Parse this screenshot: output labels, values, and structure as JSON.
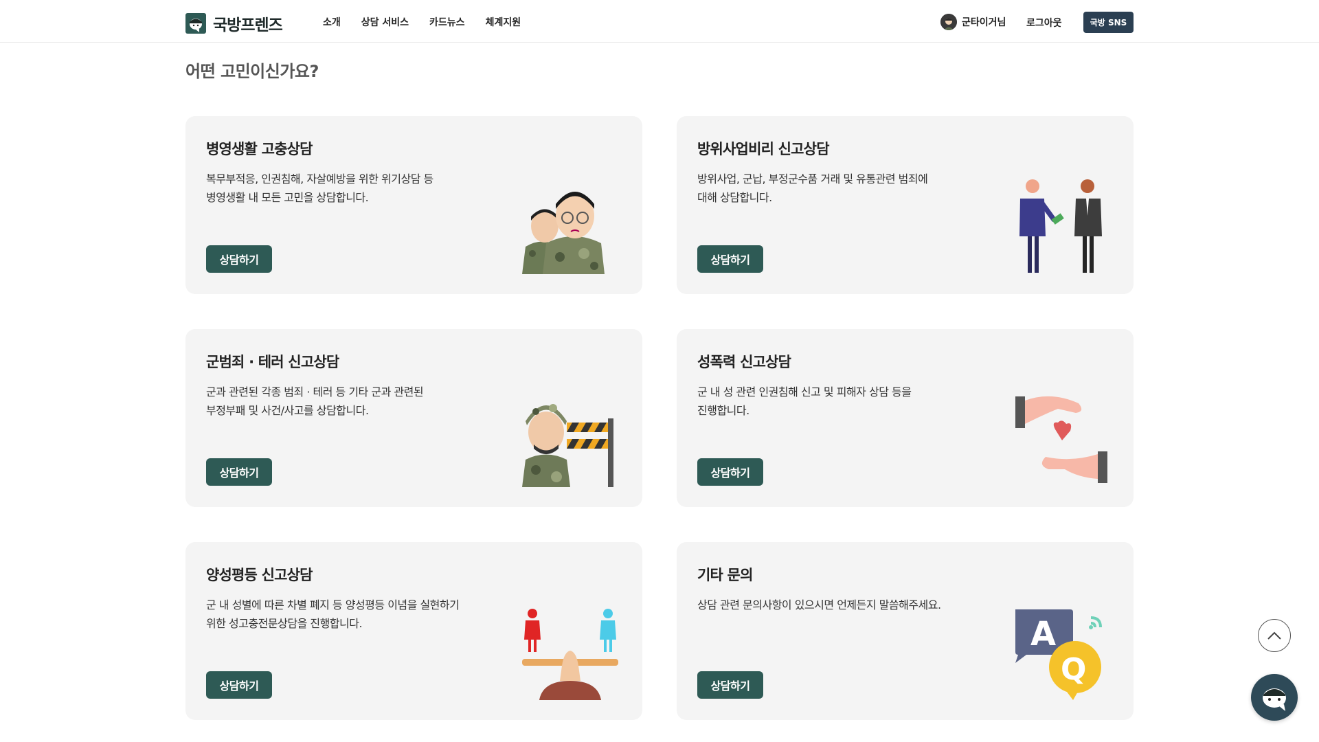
{
  "header": {
    "logo_text": "국방프렌즈",
    "nav": [
      {
        "label": "소개"
      },
      {
        "label": "상담 서비스"
      },
      {
        "label": "카드뉴스"
      },
      {
        "label": "체계지원"
      }
    ],
    "user_name": "군타이거님",
    "logout_label": "로그아웃",
    "sns_label": "국방 SNS"
  },
  "page_title": "어떤 고민이신가요?",
  "cards": [
    {
      "title": "병영생활 고충상담",
      "desc": "복무부적응, 인권침해, 자살예방을 위한 위기상담 등\n병영생활 내 모든 고민을 상담합니다.",
      "button": "상담하기",
      "icon": "soldiers-illustration"
    },
    {
      "title": "방위사업비리 신고상담",
      "desc": "방위사업, 군납, 부정군수품 거래 및 유통관련 범죄에\n대해 상담합니다.",
      "button": "상담하기",
      "icon": "bribery-illustration"
    },
    {
      "title": "군범죄 · 테러 신고상담",
      "desc": "군과 관련된 각종 범죄 · 테러 등 기타 군과 관련된\n부정부패 및 사건/사고를 상담합니다.",
      "button": "상담하기",
      "icon": "soldier-barrier-illustration"
    },
    {
      "title": "성폭력 신고상담",
      "desc": "군 내 성 관련 인권침해 신고 및 피해자 상담 등을\n진행합니다.",
      "button": "상담하기",
      "icon": "hands-heart-illustration"
    },
    {
      "title": "양성평등 신고상담",
      "desc": "군 내 성별에 따른 차별 폐지 등 양성평등 이념을 실현하기\n위한 성고충전문상담을 진행합니다.",
      "button": "상담하기",
      "icon": "gender-balance-illustration"
    },
    {
      "title": "기타 문의",
      "desc": "상담 관련 문의사항이 있으시면 언제든지 말씀해주세요.",
      "button": "상담하기",
      "icon": "qa-bubbles-illustration"
    }
  ],
  "colors": {
    "primary": "#2e5a55",
    "sns": "#2b3f52",
    "card_bg": "#f4f4f4",
    "chat": "#2e4a58"
  }
}
